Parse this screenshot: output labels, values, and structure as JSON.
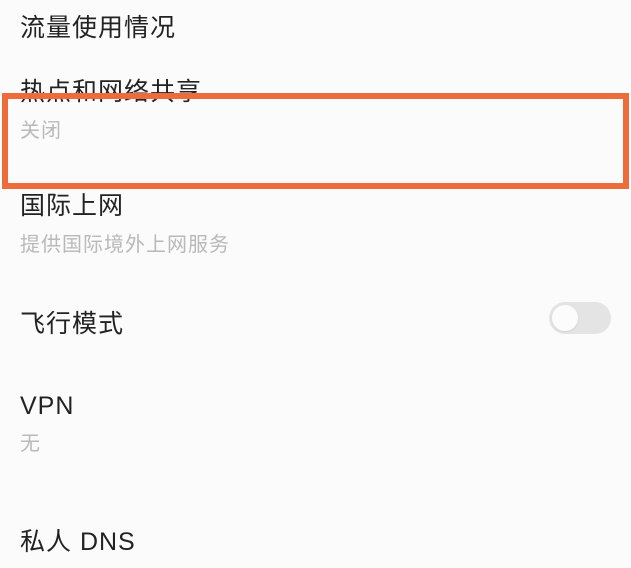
{
  "items": {
    "data_usage": {
      "title": "流量使用情况"
    },
    "hotspot": {
      "title": "热点和网络共享",
      "subtitle": "关闭"
    },
    "intl": {
      "title": "国际上网",
      "subtitle": "提供国际境外上网服务"
    },
    "airplane": {
      "title": "飞行模式",
      "toggle": false
    },
    "vpn": {
      "title": "VPN",
      "subtitle": "无"
    },
    "dns": {
      "title": "私人 DNS"
    }
  }
}
